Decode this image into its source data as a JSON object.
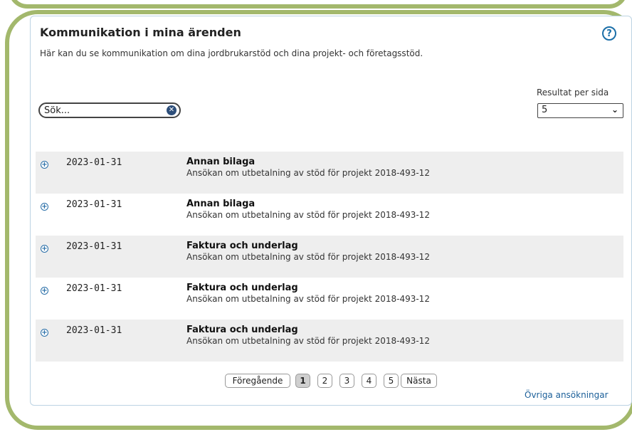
{
  "header": {
    "title": "Kommunikation i mina ärenden",
    "help_label": "?",
    "description": "Här kan du se kommunikation om dina jordbrukarstöd och dina projekt- och företagsstöd."
  },
  "search": {
    "placeholder": "Sök...",
    "value": ""
  },
  "results_per_page": {
    "label": "Resultat per sida",
    "selected": "5"
  },
  "rows": [
    {
      "date": "2023-01-31",
      "title": "Annan bilaga",
      "subtitle": "Ansökan om utbetalning av stöd för projekt 2018-493-12"
    },
    {
      "date": "2023-01-31",
      "title": "Annan bilaga",
      "subtitle": "Ansökan om utbetalning av stöd för projekt 2018-493-12"
    },
    {
      "date": "2023-01-31",
      "title": "Faktura och underlag",
      "subtitle": "Ansökan om utbetalning av stöd för projekt 2018-493-12"
    },
    {
      "date": "2023-01-31",
      "title": "Faktura och underlag",
      "subtitle": "Ansökan om utbetalning av stöd för projekt 2018-493-12"
    },
    {
      "date": "2023-01-31",
      "title": "Faktura och underlag",
      "subtitle": "Ansökan om utbetalning av stöd för projekt 2018-493-12"
    }
  ],
  "pagination": {
    "prev": "Föregående",
    "pages": [
      "1",
      "2",
      "3",
      "4",
      "5"
    ],
    "current": "1",
    "next": "Nästa"
  },
  "footer": {
    "other_link": "Övriga ansökningar"
  },
  "colors": {
    "frame": "#a3b86c",
    "link": "#1b5f99",
    "row_shade": "#eeeeee"
  }
}
